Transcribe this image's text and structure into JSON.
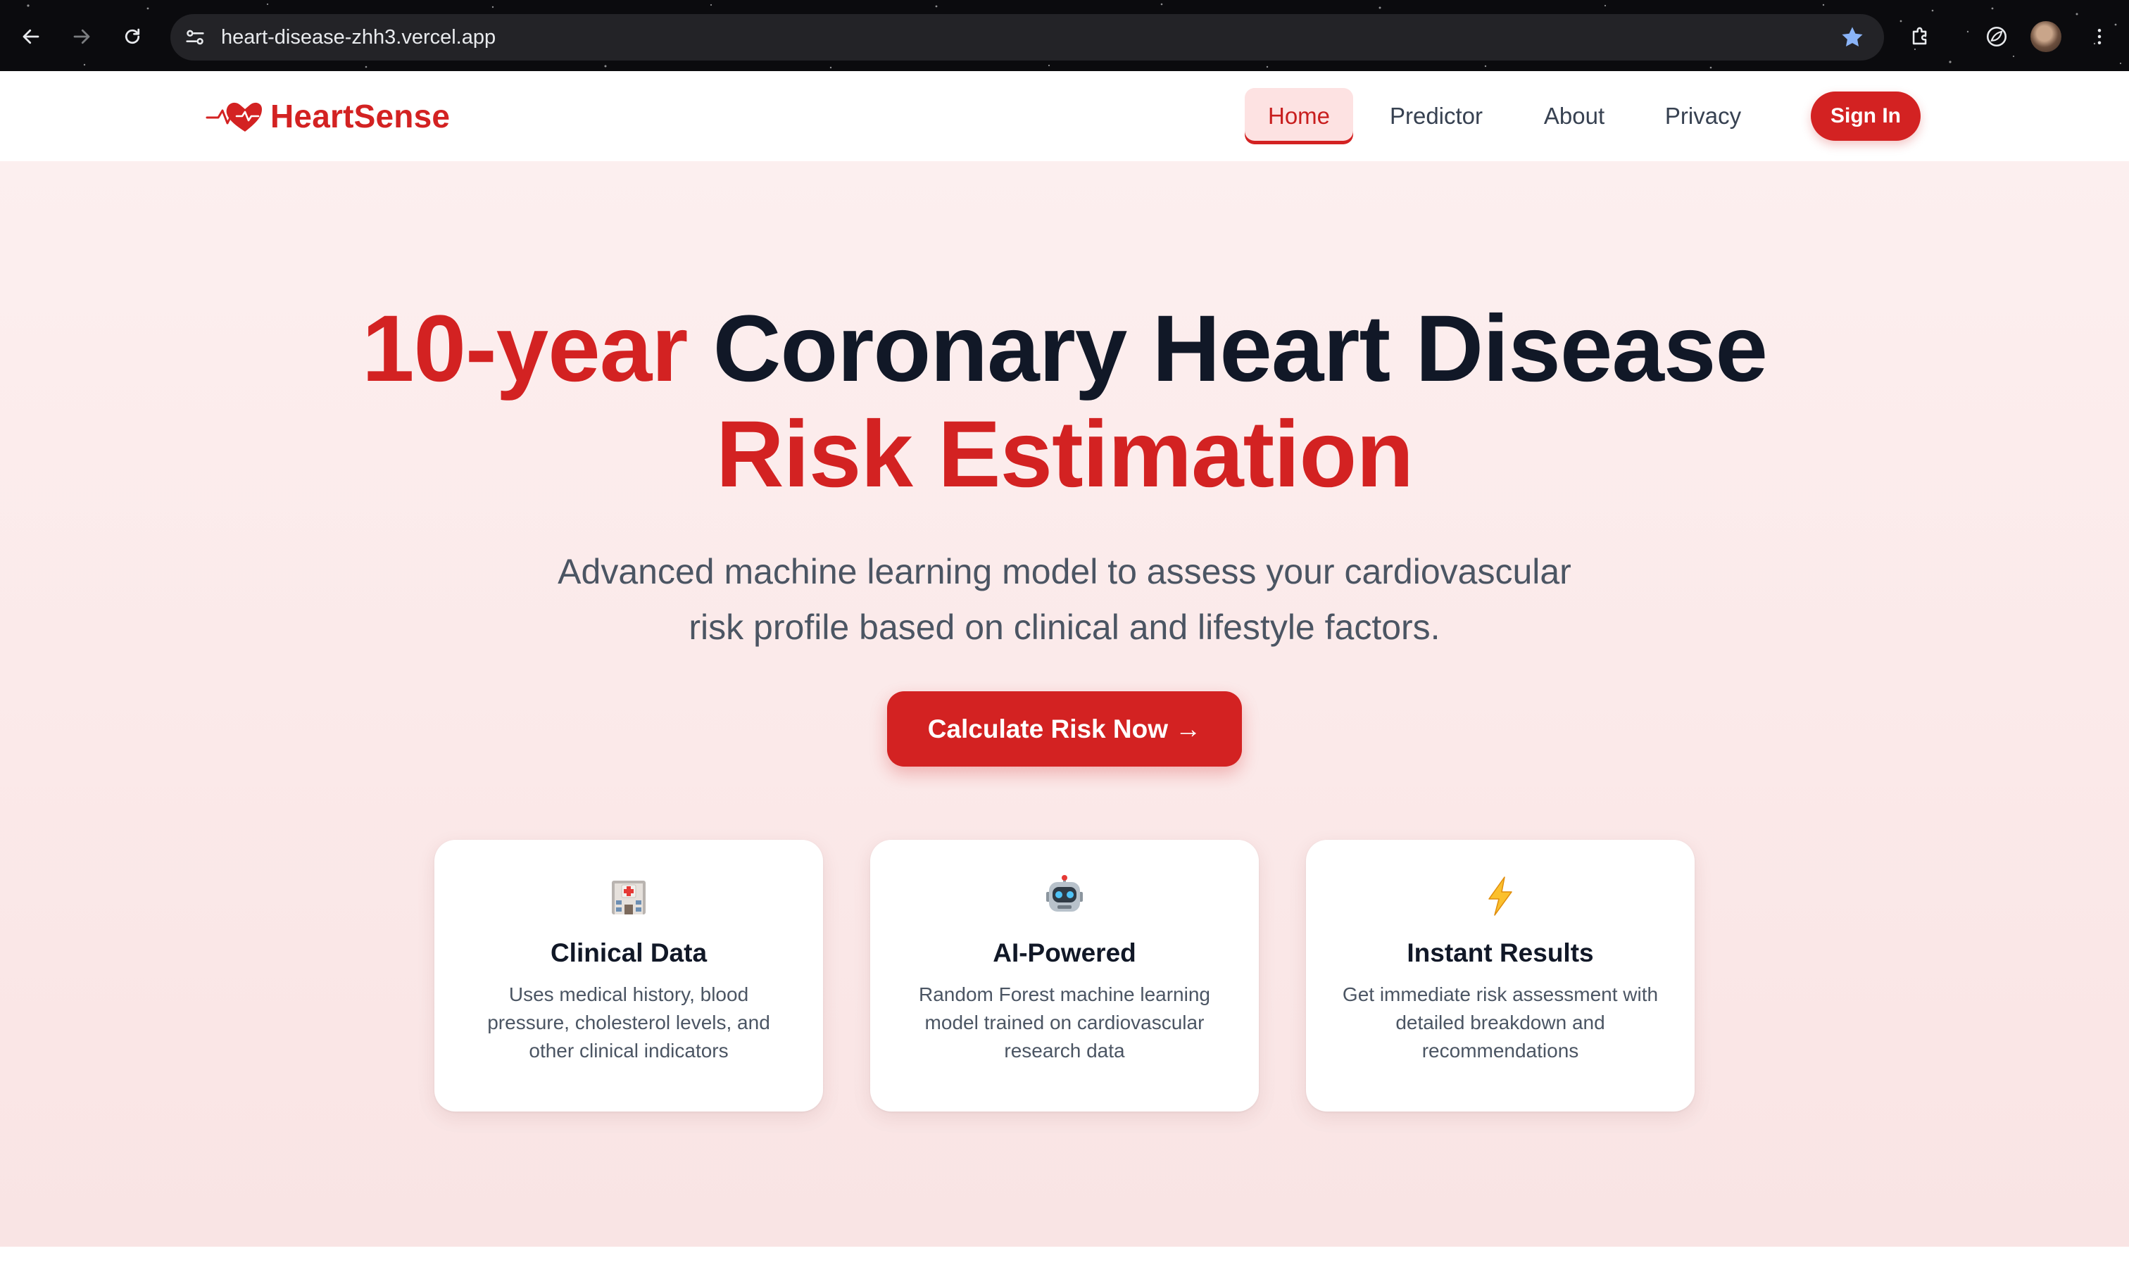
{
  "browser": {
    "url": "heart-disease-zhh3.vercel.app"
  },
  "site": {
    "brand": "HeartSense",
    "brand_color": "#d32222",
    "nav": [
      {
        "label": "Home",
        "active": true
      },
      {
        "label": "Predictor",
        "active": false
      },
      {
        "label": "About",
        "active": false
      },
      {
        "label": "Privacy",
        "active": false
      }
    ],
    "sign_in": "Sign In"
  },
  "hero": {
    "title_accent": "10-year",
    "title_main": "Coronary Heart Disease",
    "title_line2": "Risk Estimation",
    "subtitle_line1": "Advanced machine learning model to assess your cardiovascular",
    "subtitle_line2": "risk profile based on clinical and lifestyle factors.",
    "cta": "Calculate Risk Now →"
  },
  "features": [
    {
      "icon": "hospital-icon",
      "title": "Clinical Data",
      "description": "Uses medical history, blood pressure, cholesterol levels, and other clinical indicators"
    },
    {
      "icon": "robot-icon",
      "title": "AI-Powered",
      "description": "Random Forest machine learning model trained on cardiovascular research data"
    },
    {
      "icon": "lightning-icon",
      "title": "Instant Results",
      "description": "Get immediate risk assessment with detailed breakdown and recommendations"
    }
  ]
}
